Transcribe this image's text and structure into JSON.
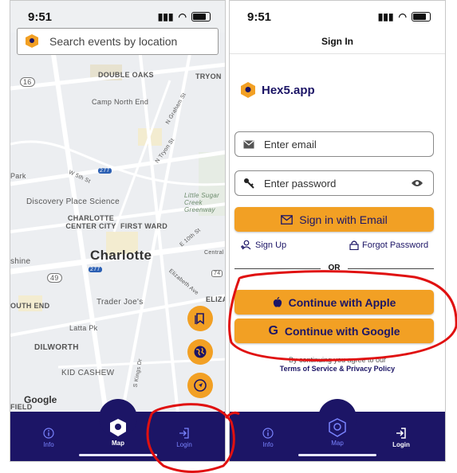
{
  "map_screen": {
    "status": {
      "time": "9:51"
    },
    "search": {
      "placeholder": "Search events by location"
    },
    "map_labels": {
      "double_oaks": "DOUBLE OAKS",
      "tryon": "TRYON",
      "camp_north_end": "Camp North End",
      "n_graham": "N Graham St",
      "n_tryon": "N Tryon St",
      "discovery": "Discovery Place Science",
      "park": "Park",
      "w5th": "W 5th St",
      "little_sugar": "Little Sugar Creek Greenway",
      "charlotte_center": "CHARLOTTE CENTER CITY",
      "first_ward": "FIRST WARD",
      "e10th": "E 10th St",
      "charlotte": "Charlotte",
      "central": "Central",
      "shine": "shine",
      "eliza": "ELIZA",
      "elizabeth_ave": "Elizabeth Ave",
      "south_end": "OUTH END",
      "trader_joes": "Trader Joe's",
      "latta_pk": "Latta Pk",
      "dilworth": "DILWORTH",
      "kid_cashew": "KID CASHEW",
      "kings_dr": "S Kings Dr",
      "field": "FIELD",
      "r16": "16",
      "r49": "49",
      "r74": "74",
      "r277": "277",
      "google": "Google"
    },
    "tabs": [
      {
        "label": "Info"
      },
      {
        "label": "Map"
      },
      {
        "label": "Login"
      }
    ]
  },
  "signin_screen": {
    "status": {
      "time": "9:51"
    },
    "title": "Sign In",
    "brand": "Hex5.app",
    "email": {
      "placeholder": "Enter email"
    },
    "password": {
      "placeholder": "Enter password"
    },
    "sign_in_email": "Sign in with Email",
    "sign_up": "Sign Up",
    "forgot_password": "Forgot Password",
    "or": "OR",
    "apple": "Continue with Apple",
    "google": "Continue with Google",
    "legal_line1": "By continuing you agree to our",
    "legal_line2": "Terms of Service & Privacy Policy",
    "tabs": [
      {
        "label": "Info"
      },
      {
        "label": "Map"
      },
      {
        "label": "Login"
      }
    ]
  },
  "colors": {
    "accent": "#f2a024",
    "navy": "#1c1566",
    "tab_inactive": "#7a84ff",
    "annotation": "#e01010"
  }
}
